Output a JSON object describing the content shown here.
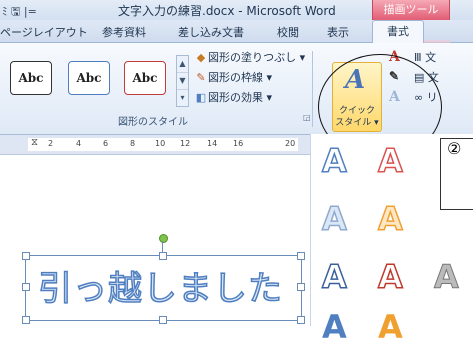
{
  "titlebar": {
    "qat": "ﾐ 🖫 |=",
    "title": "文字入力の練習.docx - Microsoft Word",
    "contextual_tab": "描画ツール"
  },
  "tabs": [
    {
      "label": "ページレイアウト"
    },
    {
      "label": "参考資料"
    },
    {
      "label": "差し込み文書"
    },
    {
      "label": "校閲"
    },
    {
      "label": "表示"
    },
    {
      "label": "書式"
    }
  ],
  "ribbon": {
    "shape_styles": [
      "Abc",
      "Abc",
      "Abc"
    ],
    "fill_label": "図形の塗りつぶし ▾",
    "outline_label": "図形の枠線 ▾",
    "effect_label": "図形の効果 ▾",
    "group_label": "図形のスタイル",
    "quick_style_line1": "クイック",
    "quick_style_line2": "スタイル ▾",
    "text_fill_icon": "A",
    "text_outline_icon": "✎",
    "text_effect_icon": "A",
    "right_1": "Ⅲ 文",
    "right_2": "▤ 文",
    "right_3": "∞ リ"
  },
  "ruler": {
    "ticks": [
      "2",
      "4",
      "6",
      "8",
      "10",
      "12",
      "14",
      "16",
      "20"
    ]
  },
  "document": {
    "wordart_text": "引っ越しました"
  },
  "wordart_gallery": {
    "glyph": "A"
  },
  "annotation": {
    "label": "②"
  },
  "colors": {
    "context_tab": "#e25d74",
    "wordart_outline": "#4f7fc0",
    "gallery_red": "#d9534f",
    "gallery_orange": "#f0a030"
  }
}
